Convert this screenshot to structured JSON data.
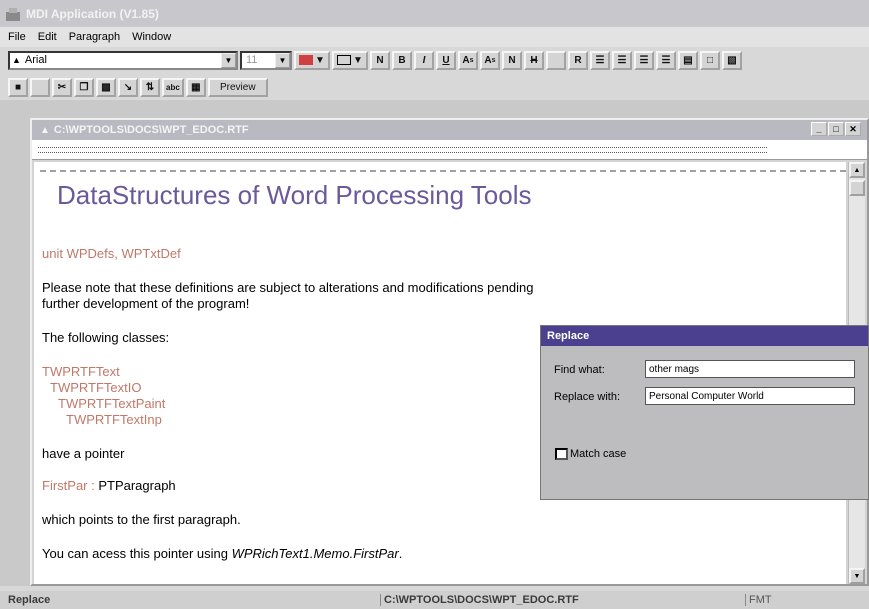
{
  "window": {
    "title": "MDI Application (V1.85)"
  },
  "menu": [
    "File",
    "Edit",
    "Paragraph",
    "Window"
  ],
  "toolbar": {
    "font": "Arial",
    "size": "11",
    "format_buttons": [
      "N",
      "B",
      "I",
      "U",
      "A",
      "A",
      "N",
      "H",
      "",
      "R"
    ],
    "preview_label": "Preview"
  },
  "document": {
    "window_title": "C:\\WPTOOLS\\DOCS\\WPT_EDOC.RTF",
    "heading": "DataStructures of Word Processing Tools",
    "unit_line": "unit WPDefs, WPTxtDef",
    "note_line1": "Please note that these definitions are subject to alterations and modifications pending",
    "note_line2": "further development of the program!",
    "following": "The following classes:",
    "classes": [
      "TWPRTFText",
      "TWPRTFTextIO",
      "TWPRTFTextPaint",
      "TWPRTFTextInp"
    ],
    "have_pointer": "have a pointer",
    "firstpar_label": "FirstPar",
    "firstpar_sep": " : ",
    "firstpar_type": "PTParagraph",
    "points_to": "which points to the first paragraph.",
    "access_prefix": "You can acess this pointer using ",
    "access_code": "WPRichText1.Memo.FirstPar",
    "access_suffix": "."
  },
  "replace_dialog": {
    "title": "Replace",
    "find_label": "Find what:",
    "find_value": "other mags",
    "replace_label": "Replace with:",
    "replace_value": "Personal Computer World",
    "match_case_label": "Match case"
  },
  "status": {
    "left": "Replace",
    "path": "C:\\WPTOOLS\\DOCS\\WPT_EDOC.RTF",
    "mode": "FMT"
  }
}
